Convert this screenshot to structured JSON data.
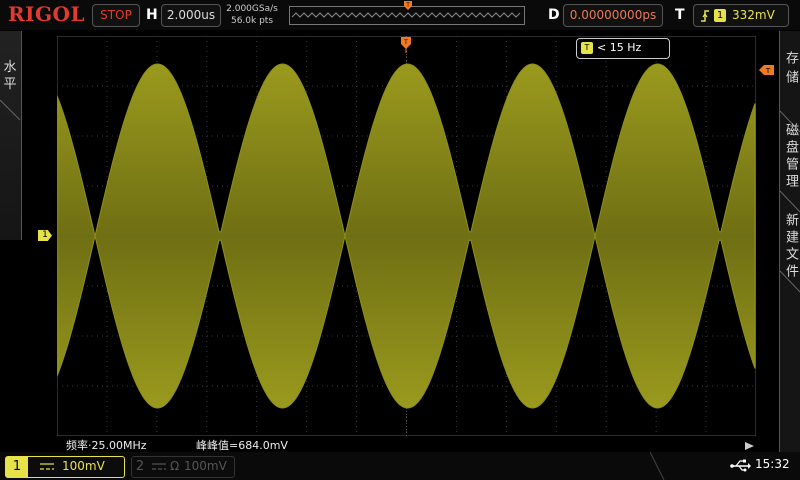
{
  "brand": "RIGOL",
  "header": {
    "run_state": "STOP",
    "timebase_letter": "H",
    "timebase": "2.000us",
    "sample_rate": "2.000GSa/s",
    "memory_depth": "56.0k pts",
    "delay_letter": "D",
    "delay": "0.00000000ps",
    "trigger_letter": "T",
    "trigger_channel": "1",
    "trigger_level": "332mV"
  },
  "left_menu": {
    "label": "水平"
  },
  "right_menu": {
    "items": [
      {
        "label": "存储"
      },
      {
        "label": "磁盘管理"
      },
      {
        "label": "新建文件"
      }
    ]
  },
  "screen": {
    "trigger_readout": "< 15 Hz",
    "trigger_readout_tag": "T",
    "channel_marker": "1",
    "waveform_color": "#8f8f1c",
    "measurements": {
      "frequency": "频率·25.00MHz",
      "peak_to_peak": "峰峰值=684.0mV"
    }
  },
  "bottom": {
    "ch1": {
      "number": "1",
      "coupling": "DC",
      "scale": "100mV",
      "color": "#e8e24a"
    },
    "ch2": {
      "number": "2",
      "coupling_symbol": "Ω",
      "scale": "100mV"
    },
    "usb_icon": "usb-icon",
    "time": "15:32"
  },
  "colors": {
    "accent_red": "#e23a2e",
    "ch1_yellow": "#e8e24a",
    "trigger_orange": "#f07a20"
  }
}
